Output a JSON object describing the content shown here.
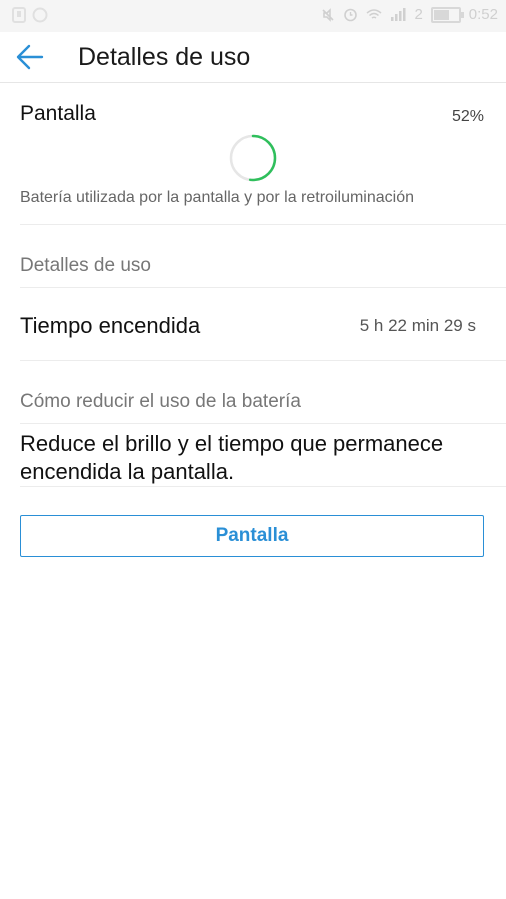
{
  "status_bar": {
    "sim": "2",
    "time": "0:52",
    "icons": [
      "sim-card-icon",
      "whatsapp-icon",
      "mute-icon",
      "alarm-icon",
      "wifi-icon",
      "signal-icon",
      "battery-icon"
    ]
  },
  "app_bar": {
    "title": "Detalles de uso",
    "back_icon": "arrow-left-icon"
  },
  "screen_usage": {
    "label": "Pantalla",
    "percent": "52%",
    "progress_fraction": 0.52,
    "description": "Batería utilizada por la pantalla y por la retroiluminación"
  },
  "usage_details": {
    "header": "Detalles de uso",
    "on_time_label": "Tiempo encendida",
    "on_time_value": "5 h 22 min 29 s"
  },
  "reduce": {
    "header": "Cómo reducir el uso de la batería",
    "tip": "Reduce el brillo y el tiempo que permanece encendida la pantalla."
  },
  "action_button": {
    "label": "Pantalla"
  },
  "colors": {
    "accent": "#2a8fd6",
    "progress": "#2fbf5c"
  }
}
